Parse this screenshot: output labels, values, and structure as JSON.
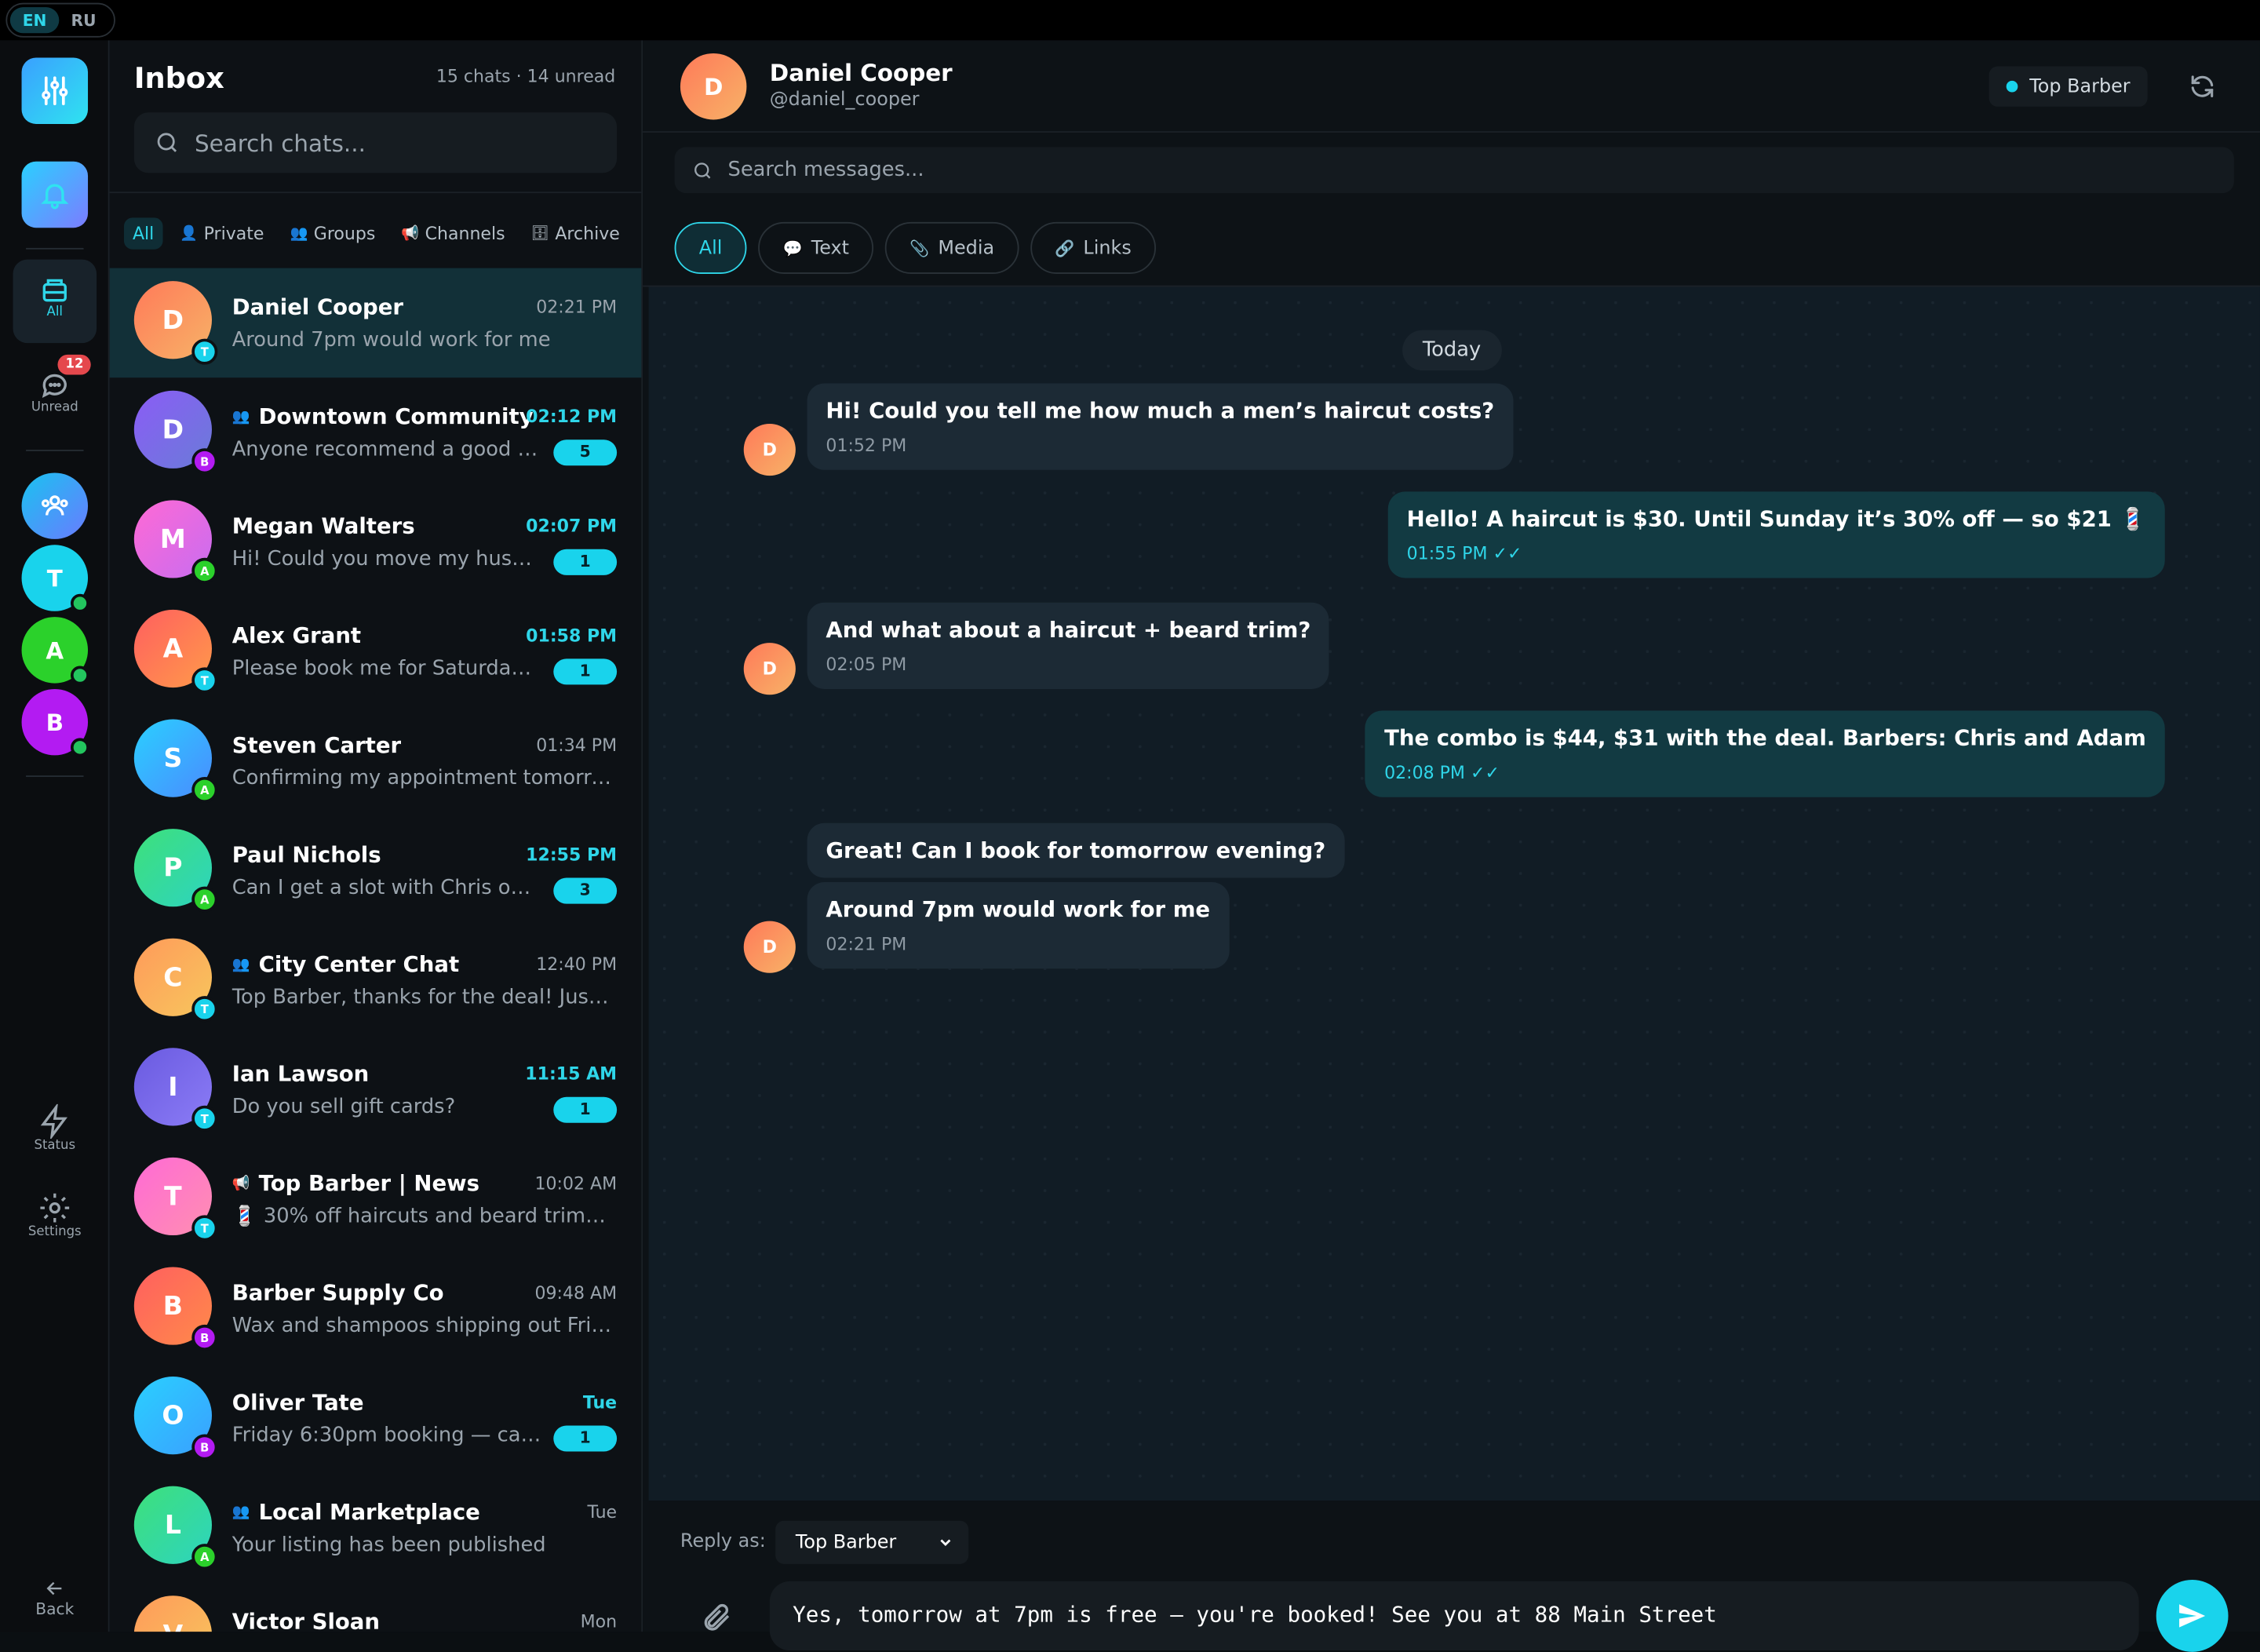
{
  "lang": {
    "options": [
      "EN",
      "RU"
    ],
    "selected": "EN"
  },
  "rail": {
    "top_icons": [
      "sliders-icon",
      "bell-icon"
    ],
    "tabs": [
      {
        "label": "All",
        "icon": "inbox-icon",
        "active": true
      },
      {
        "label": "Unread",
        "icon": "chat-bubble-icon",
        "badge": "12"
      }
    ],
    "avatars": [
      {
        "letter": "",
        "icon": "group-icon",
        "color": "#19c3f0"
      },
      {
        "letter": "T",
        "color": "#19d3ec",
        "online": true
      },
      {
        "letter": "A",
        "color": "#2bd12b",
        "online": true
      },
      {
        "letter": "B",
        "color": "#b31bf2",
        "online": true
      }
    ],
    "bottom": [
      {
        "label": "Status",
        "icon": "lightning-icon"
      },
      {
        "label": "Settings",
        "icon": "gear-icon"
      },
      {
        "label": "Back",
        "icon": "arrow-left-icon"
      }
    ]
  },
  "inbox": {
    "title": "Inbox",
    "meta": "15 chats · 14 unread",
    "search_placeholder": "Search chats...",
    "filters": [
      {
        "label": "All",
        "icon": "",
        "active": true
      },
      {
        "label": "Private",
        "icon": "👤"
      },
      {
        "label": "Groups",
        "icon": "👥"
      },
      {
        "label": "Channels",
        "icon": "📢"
      },
      {
        "label": "Archive",
        "icon": "🗄"
      }
    ],
    "chats": [
      {
        "letter": "D",
        "name": "Daniel Cooper",
        "preview": "Around 7pm would work for me",
        "time": "02:21 PM",
        "badge": "",
        "mini": "T",
        "mini_color": "#19d3ec",
        "grad": [
          "#ff7a59",
          "#f7b267"
        ],
        "active": true,
        "group": false
      },
      {
        "letter": "D",
        "name": "Downtown Community",
        "preview": "Anyone recommend a good b...",
        "time": "02:12 PM",
        "badge": "5",
        "mini": "B",
        "mini_color": "#b31bf2",
        "grad": [
          "#8b5cf6",
          "#6a7bd8"
        ],
        "group": true
      },
      {
        "letter": "M",
        "name": "Megan Walters",
        "preview": "Hi! Could you move my husba...",
        "time": "02:07 PM",
        "badge": "1",
        "mini": "A",
        "mini_color": "#2bd12b",
        "grad": [
          "#ff6ad5",
          "#c86cf0"
        ],
        "group": false
      },
      {
        "letter": "A",
        "name": "Alex Grant",
        "preview": "Please book me for Saturday ...",
        "time": "01:58 PM",
        "badge": "1",
        "mini": "T",
        "mini_color": "#19d3ec",
        "grad": [
          "#ff5f5f",
          "#ff9a4a"
        ],
        "group": false
      },
      {
        "letter": "S",
        "name": "Steven Carter",
        "preview": "Confirming my appointment tomorro...",
        "time": "01:34 PM",
        "badge": "",
        "mini": "A",
        "mini_color": "#2bd12b",
        "grad": [
          "#2ad0ff",
          "#4a8bff"
        ],
        "group": false
      },
      {
        "letter": "P",
        "name": "Paul Nichols",
        "preview": "Can I get a slot with Chris on ...",
        "time": "12:55 PM",
        "badge": "3",
        "mini": "A",
        "mini_color": "#2bd12b",
        "grad": [
          "#3ee07a",
          "#2dd4bf"
        ],
        "group": false
      },
      {
        "letter": "C",
        "name": "City Center Chat",
        "preview": "Top Barber, thanks for the deal! Just ...",
        "time": "12:40 PM",
        "badge": "",
        "mini": "T",
        "mini_color": "#19d3ec",
        "grad": [
          "#ff9a5a",
          "#f7c65d"
        ],
        "group": true
      },
      {
        "letter": "I",
        "name": "Ian Lawson",
        "preview": "Do you sell gift cards?",
        "time": "11:15 AM",
        "badge": "1",
        "mini": "T",
        "mini_color": "#19d3ec",
        "grad": [
          "#6a5ae0",
          "#8b7cf6"
        ],
        "group": false
      },
      {
        "letter": "T",
        "name": "Top Barber | News",
        "preview": "💈 30% off haircuts and beard trims ...",
        "time": "10:02 AM",
        "badge": "",
        "mini": "T",
        "mini_color": "#19d3ec",
        "grad": [
          "#ff6ad5",
          "#ff8fb1"
        ],
        "channel": true
      },
      {
        "letter": "B",
        "name": "Barber Supply Co",
        "preview": "Wax and shampoos shipping out Frid...",
        "time": "09:48 AM",
        "badge": "",
        "mini": "B",
        "mini_color": "#b31bf2",
        "grad": [
          "#ff5f5f",
          "#ff8a4a"
        ],
        "group": false
      },
      {
        "letter": "O",
        "name": "Oliver Tate",
        "preview": "Friday 6:30pm booking — can...",
        "time": "Tue",
        "badge": "1",
        "mini": "B",
        "mini_color": "#b31bf2",
        "grad": [
          "#2ad0ff",
          "#3aa0ff"
        ],
        "group": false
      },
      {
        "letter": "L",
        "name": "Local Marketplace",
        "preview": "Your listing has been published",
        "time": "Tue",
        "badge": "",
        "mini": "A",
        "mini_color": "#2bd12b",
        "grad": [
          "#3ee07a",
          "#2dd4bf"
        ],
        "group": true
      },
      {
        "letter": "V",
        "name": "Victor Sloan",
        "preview": "",
        "time": "Mon",
        "badge": "",
        "mini": "",
        "mini_color": "",
        "grad": [
          "#ff9a5a",
          "#f7c65d"
        ],
        "group": false
      }
    ]
  },
  "chat": {
    "contact_letter": "D",
    "contact_name": "Daniel Cooper",
    "contact_handle": "@daniel_cooper",
    "account_pill": "Top Barber",
    "search_placeholder": "Search messages...",
    "chips": [
      {
        "label": "All",
        "icon": "",
        "active": true
      },
      {
        "label": "Text",
        "icon": "💬"
      },
      {
        "label": "Media",
        "icon": "📎"
      },
      {
        "label": "Links",
        "icon": "🔗"
      }
    ],
    "day_label": "Today",
    "messages": [
      {
        "dir": "in",
        "text": "Hi! Could you tell me how much a men’s haircut costs?",
        "time": "01:52 PM",
        "avatar": "D"
      },
      {
        "dir": "out",
        "text": "Hello! A haircut is $30. Until Sunday it’s 30% off — so $21 💈",
        "time": "01:55 PM",
        "ticks": "✓✓"
      },
      {
        "dir": "in",
        "text": "And what about a haircut + beard trim?",
        "time": "02:05 PM",
        "avatar": "D"
      },
      {
        "dir": "out",
        "text": "The combo is $44, $31 with the deal. Barbers: Chris and Adam",
        "time": "02:08 PM",
        "ticks": "✓✓"
      },
      {
        "dir": "in",
        "text": "Great! Can I book for tomorrow evening?",
        "time": "",
        "avatar": ""
      },
      {
        "dir": "in",
        "text": "Around 7pm would work for me",
        "time": "02:21 PM",
        "avatar": "D"
      }
    ],
    "reply_label": "Reply as:",
    "reply_as": "Top Barber",
    "draft": "Yes, tomorrow at 7pm is free — you're booked! See you at 88 Main Street"
  },
  "colors": {
    "accent": "#19d3ec",
    "unread_badge": "#e5484d",
    "active_row": "#123038"
  }
}
